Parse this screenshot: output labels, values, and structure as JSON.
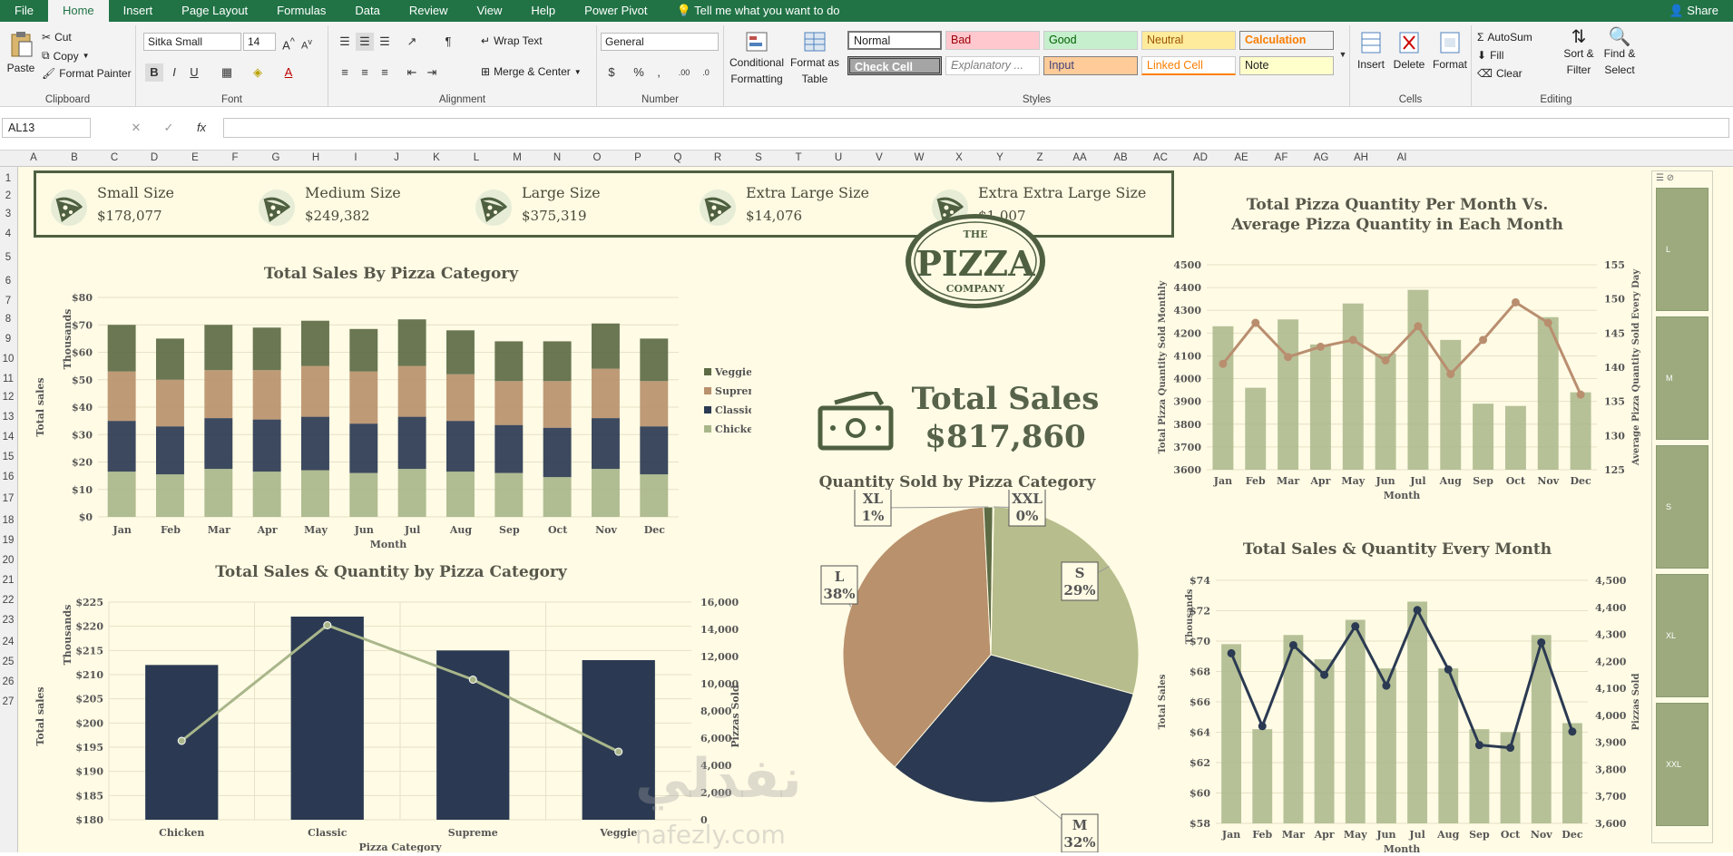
{
  "menu": {
    "file": "File",
    "home": "Home",
    "insert": "Insert",
    "page_layout": "Page Layout",
    "formulas": "Formulas",
    "data": "Data",
    "review": "Review",
    "view": "View",
    "help": "Help",
    "power_pivot": "Power Pivot",
    "tell_me": "Tell me what you want to do",
    "share": "Share"
  },
  "ribbon": {
    "clipboard": {
      "label": "Clipboard",
      "paste": "Paste",
      "cut": "Cut",
      "copy": "Copy",
      "format_painter": "Format Painter"
    },
    "font": {
      "label": "Font",
      "family": "Sitka Small",
      "size": "14"
    },
    "alignment": {
      "label": "Alignment",
      "wrap": "Wrap Text",
      "merge": "Merge & Center"
    },
    "number": {
      "label": "Number",
      "format": "General"
    },
    "styles": {
      "label": "Styles",
      "cond": "Conditional",
      "cond2": "Formatting",
      "fmt_table": "Format as",
      "fmt_table2": "Table",
      "normal": "Normal",
      "bad": "Bad",
      "good": "Good",
      "neutral": "Neutral",
      "calculation": "Calculation",
      "check_cell": "Check Cell",
      "explanatory": "Explanatory ...",
      "input": "Input",
      "linked": "Linked Cell",
      "note": "Note"
    },
    "cells": {
      "label": "Cells",
      "insert": "Insert",
      "delete": "Delete",
      "format": "Format"
    },
    "editing": {
      "label": "Editing",
      "autosum": "AutoSum",
      "fill": "Fill",
      "clear": "Clear",
      "sort": "Sort &",
      "sort2": "Filter",
      "find": "Find &",
      "find2": "Select"
    }
  },
  "formula_bar": {
    "name_box": "AL13",
    "formula": ""
  },
  "columns": [
    "A",
    "B",
    "C",
    "D",
    "E",
    "F",
    "G",
    "H",
    "I",
    "J",
    "K",
    "L",
    "M",
    "N",
    "O",
    "P",
    "Q",
    "R",
    "S",
    "T",
    "U",
    "V",
    "W",
    "X",
    "Y",
    "Z",
    "AA",
    "AB",
    "AC",
    "AD",
    "AE",
    "AF",
    "AG",
    "AH",
    "AI"
  ],
  "rows": [
    "1",
    "2",
    "3",
    "4",
    "5",
    "6",
    "7",
    "8",
    "9",
    "10",
    "11",
    "12",
    "13",
    "14",
    "15",
    "16",
    "17",
    "18",
    "19",
    "20",
    "21",
    "22",
    "23",
    "24",
    "25",
    "26",
    "27"
  ],
  "kpis": [
    {
      "label": "Small Size",
      "value": "$178,077"
    },
    {
      "label": "Medium Size",
      "value": "$249,382"
    },
    {
      "label": "Large Size",
      "value": "$375,319"
    },
    {
      "label": "Extra Large Size",
      "value": "$14,076"
    },
    {
      "label": "Extra Extra Large Size",
      "value": "$1,007"
    }
  ],
  "logo": {
    "line1": "THE",
    "line2": "PIZZA",
    "line3": "COMPANY"
  },
  "total_sales": {
    "label": "Total Sales",
    "value": "$817,860"
  },
  "slicer": {
    "items": [
      "L",
      "M",
      "S",
      "XL",
      "XXL"
    ]
  },
  "watermark": {
    "arabic": "نفذلي",
    "latin": "nafezly.com"
  },
  "colors": {
    "green": "#5d6b45",
    "tan": "#b9916d",
    "navy": "#2b3a52",
    "light_green": "#a9b68a",
    "line_tan": "#b98e6f"
  },
  "chart_data": [
    {
      "type": "bar",
      "stacked": true,
      "title": "Total Sales By Pizza Category",
      "xlabel": "Month",
      "ylabel": "Total sales",
      "yunit": "Thousands",
      "categories": [
        "Jan",
        "Feb",
        "Mar",
        "Apr",
        "May",
        "Jun",
        "Jul",
        "Aug",
        "Sep",
        "Oct",
        "Nov",
        "Dec"
      ],
      "yticks": [
        "$0",
        "$10",
        "$20",
        "$30",
        "$40",
        "$50",
        "$60",
        "$70",
        "$80"
      ],
      "ylim": [
        0,
        80
      ],
      "series": [
        {
          "name": "Chicken",
          "values": [
            16.5,
            15.5,
            17.5,
            16.5,
            17,
            16,
            17.5,
            16.5,
            16,
            14.5,
            17.5,
            15.5
          ]
        },
        {
          "name": "Classic",
          "values": [
            18.5,
            17.5,
            18.5,
            19,
            19.5,
            18,
            19,
            18.5,
            17.5,
            18,
            18.5,
            17.5
          ]
        },
        {
          "name": "Supreme",
          "values": [
            18,
            17,
            17.5,
            18,
            18.5,
            19,
            18.5,
            17,
            16,
            17,
            18,
            16.5
          ]
        },
        {
          "name": "Veggie",
          "values": [
            17,
            15,
            16.5,
            15.5,
            16.5,
            15.5,
            17,
            16,
            14.5,
            14.5,
            16.5,
            15.5
          ]
        }
      ],
      "legend": "right",
      "legend_order": [
        "Veggie",
        "Supreme",
        "Classic",
        "Chicken"
      ]
    },
    {
      "type": "bar+line",
      "title": "Total Sales & Quantity by Pizza Category",
      "xlabel": "Pizza Category",
      "ylabel": "Total sales",
      "yunit": "Thousands",
      "y2label": "Pizzas Sold",
      "categories": [
        "Chicken",
        "Classic",
        "Supreme",
        "Veggie"
      ],
      "yticks": [
        "$180",
        "$185",
        "$190",
        "$195",
        "$200",
        "$205",
        "$210",
        "$215",
        "$220",
        "$225"
      ],
      "ylim": [
        180,
        225
      ],
      "y2ticks": [
        "0",
        "2,000",
        "4,000",
        "6,000",
        "8,000",
        "10,000",
        "12,000",
        "14,000",
        "16,000"
      ],
      "y2lim": [
        0,
        16000
      ],
      "bars": [
        212,
        222,
        215,
        213
      ],
      "line": [
        5800,
        14300,
        10300,
        5000
      ]
    },
    {
      "type": "pie",
      "title": "Quantity Sold by Pizza Category",
      "slices": [
        {
          "label": "S",
          "percent_label": "29%",
          "value": 29
        },
        {
          "label": "M",
          "percent_label": "32%",
          "value": 32
        },
        {
          "label": "L",
          "percent_label": "38%",
          "value": 38
        },
        {
          "label": "XL",
          "percent_label": "1%",
          "value": 1
        },
        {
          "label": "XXL",
          "percent_label": "0%",
          "value": 0.1
        }
      ]
    },
    {
      "type": "bar+line",
      "title": "Total Pizza Quantity Per Month Vs. Average Pizza Quantity in Each Month",
      "title_line1": "Total Pizza Quantity Per Month Vs.",
      "title_line2": "Average Pizza Quantity in Each Month",
      "xlabel": "Month",
      "ylabel": "Total Pizza Quantity Sold Monthly",
      "y2label": "Average Pizza Quantity Sold Every Day",
      "categories": [
        "Jan",
        "Feb",
        "Mar",
        "Apr",
        "May",
        "Jun",
        "Jul",
        "Aug",
        "Sep",
        "Oct",
        "Nov",
        "Dec"
      ],
      "yticks": [
        "3600",
        "3700",
        "3800",
        "3900",
        "4000",
        "4100",
        "4200",
        "4300",
        "4400",
        "4500"
      ],
      "ylim": [
        3600,
        4500
      ],
      "y2ticks": [
        "125",
        "130",
        "135",
        "140",
        "145",
        "150",
        "155"
      ],
      "y2lim": [
        125,
        155
      ],
      "bars": [
        4230,
        3960,
        4260,
        4150,
        4330,
        4110,
        4390,
        4170,
        3890,
        3880,
        4270,
        3940
      ],
      "line": [
        140.5,
        146.5,
        141.5,
        143,
        144,
        141,
        146,
        139,
        144,
        149.5,
        146.5,
        136
      ]
    },
    {
      "type": "bar+line",
      "title": "Total Sales & Quantity Every Month",
      "xlabel": "Month",
      "ylabel": "Total Sales",
      "yunit": "Thousands",
      "y2label": "Pizzas Sold",
      "categories": [
        "Jan",
        "Feb",
        "Mar",
        "Apr",
        "May",
        "Jun",
        "Jul",
        "Aug",
        "Sep",
        "Oct",
        "Nov",
        "Dec"
      ],
      "yticks": [
        "$58",
        "$60",
        "$62",
        "$64",
        "$66",
        "$68",
        "$70",
        "$72",
        "$74"
      ],
      "ylim": [
        58,
        74
      ],
      "y2ticks": [
        "3,600",
        "3,700",
        "3,800",
        "3,900",
        "4,000",
        "4,100",
        "4,200",
        "4,300",
        "4,400",
        "4,500"
      ],
      "y2lim": [
        3600,
        4500
      ],
      "bars": [
        69.8,
        64.2,
        70.4,
        68.8,
        71.4,
        68.2,
        72.6,
        68.2,
        64.2,
        64.0,
        70.4,
        64.6
      ],
      "line": [
        4230,
        3960,
        4260,
        4150,
        4330,
        4110,
        4390,
        4170,
        3890,
        3880,
        4270,
        3940
      ]
    }
  ]
}
